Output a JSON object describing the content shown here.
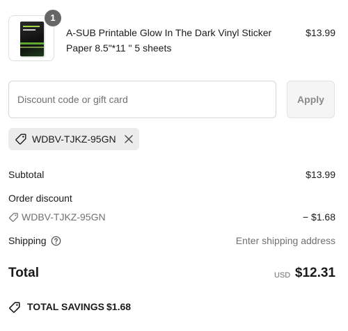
{
  "cart": {
    "item": {
      "quantity": "1",
      "title_line1": "A-SUB Printable Glow In The Dark Vinyl Sticker",
      "title_line2": "Paper 8.5\"*11 \" 5 sheets",
      "price": "$13.99"
    }
  },
  "discount": {
    "placeholder": "Discount code or gift card",
    "apply_label": "Apply",
    "applied_code": "WDBV-TJKZ-95GN"
  },
  "summary": {
    "subtotal_label": "Subtotal",
    "subtotal_value": "$13.99",
    "order_discount_label": "Order discount",
    "discount_code": "WDBV-TJKZ-95GN",
    "discount_value": "− $1.68",
    "shipping_label": "Shipping",
    "shipping_value": "Enter shipping address",
    "total_label": "Total",
    "currency": "USD",
    "total_value": "$12.31",
    "savings_label": "TOTAL SAVINGS",
    "savings_value": "$1.68"
  },
  "icons": {
    "tag": "tag-icon",
    "remove": "close-icon",
    "help": "question-circle-icon"
  },
  "colors": {
    "badge": "#666666",
    "chip_bg": "#ececec",
    "muted_text": "#707070"
  }
}
